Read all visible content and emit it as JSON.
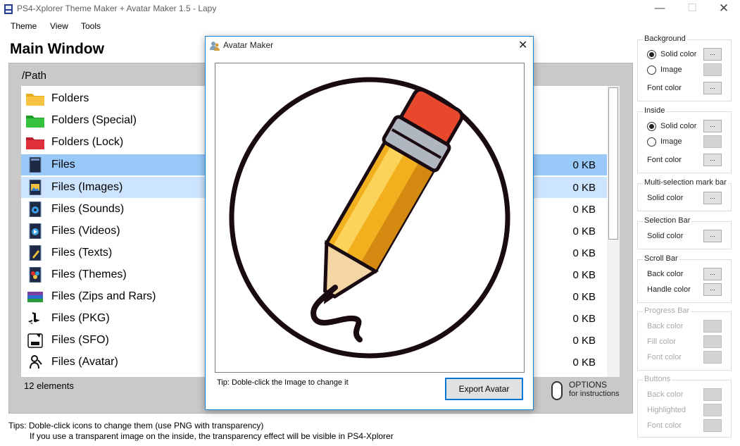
{
  "window": {
    "title": "PS4-Xplorer Theme Maker + Avatar Maker 1.5 - Lapy",
    "minimize": "—",
    "maximize": "☐",
    "close": "✕"
  },
  "menu": [
    "Theme",
    "View",
    "Tools"
  ],
  "main": {
    "title": "Main Window",
    "path": "/Path",
    "rows": [
      {
        "label": "Folders",
        "size": "",
        "icon": "folder-yellow-icon"
      },
      {
        "label": "Folders (Special)",
        "size": "",
        "icon": "folder-green-icon"
      },
      {
        "label": "Folders (Lock)",
        "size": "",
        "icon": "folder-red-icon"
      },
      {
        "label": "Files",
        "size": "0 KB",
        "icon": "file-icon"
      },
      {
        "label": "Files (Images)",
        "size": "0 KB",
        "icon": "image-file-icon"
      },
      {
        "label": "Files (Sounds)",
        "size": "0 KB",
        "icon": "sound-file-icon"
      },
      {
        "label": "Files (Videos)",
        "size": "0 KB",
        "icon": "video-file-icon"
      },
      {
        "label": "Files (Texts)",
        "size": "0 KB",
        "icon": "text-file-icon"
      },
      {
        "label": "Files (Themes)",
        "size": "0 KB",
        "icon": "theme-file-icon"
      },
      {
        "label": "Files (Zips and Rars)",
        "size": "0 KB",
        "icon": "archive-file-icon"
      },
      {
        "label": "Files (PKG)",
        "size": "0 KB",
        "icon": "playstation-icon"
      },
      {
        "label": "Files (SFO)",
        "size": "0 KB",
        "icon": "sfo-file-icon"
      },
      {
        "label": "Files (Avatar)",
        "size": "0 KB",
        "icon": "avatar-file-icon"
      }
    ],
    "elements_count": "12 elements",
    "options_label": "OPTIONS",
    "options_sub": "for instructions"
  },
  "tips": {
    "line1": "Tips: Doble-click icons to change them (use PNG with transparency)",
    "line2": "If you use a transparent image on the inside, the transparency effect will be visible in PS4-Xplorer"
  },
  "groups": {
    "background": {
      "title": "Background",
      "solid": "Solid color",
      "image": "Image",
      "font": "Font color"
    },
    "inside": {
      "title": "Inside",
      "solid": "Solid color",
      "image": "Image",
      "font": "Font color"
    },
    "multisel": {
      "title": "Multi-selection mark bar",
      "solid": "Solid color"
    },
    "selection": {
      "title": "Selection Bar",
      "solid": "Solid color"
    },
    "scroll": {
      "title": "Scroll Bar",
      "back": "Back color",
      "handle": "Handle color"
    },
    "progress": {
      "title": "Progress Bar",
      "back": "Back color",
      "fill": "Fill color",
      "font": "Font color"
    },
    "buttons": {
      "title": "Buttons",
      "back": "Back color",
      "highlighted": "Highlighted",
      "font": "Font color"
    },
    "pick_label": "..."
  },
  "dialog": {
    "title": "Avatar Maker",
    "close": "✕",
    "tip": "Tip: Doble-click the Image to change it",
    "export": "Export Avatar"
  },
  "colors": {
    "selection": "#99c9f9",
    "multiselection": "#cce4fd",
    "accent": "#0078d7",
    "panel": "#c9c9c9"
  }
}
